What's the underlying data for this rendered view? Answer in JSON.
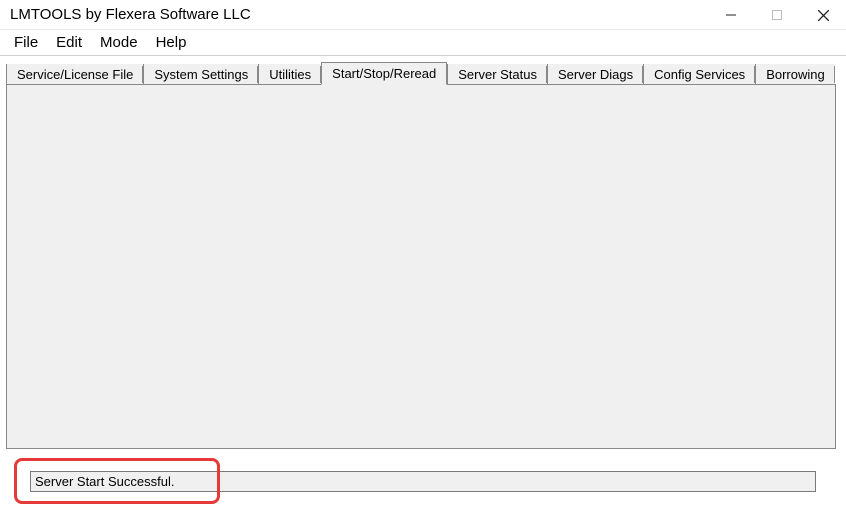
{
  "window": {
    "title": "LMTOOLS by Flexera Software LLC"
  },
  "menu": {
    "file": "File",
    "edit": "Edit",
    "mode": "Mode",
    "help": "Help"
  },
  "tabs": {
    "service": "Service/License File",
    "system": "System Settings",
    "utilities": "Utilities",
    "startstop": "Start/Stop/Reread",
    "serverstatus": "Server Status",
    "serverdiags": "Server Diags",
    "config": "Config Services",
    "borrowing": "Borrowing"
  },
  "status": {
    "message": "Server Start Successful."
  }
}
